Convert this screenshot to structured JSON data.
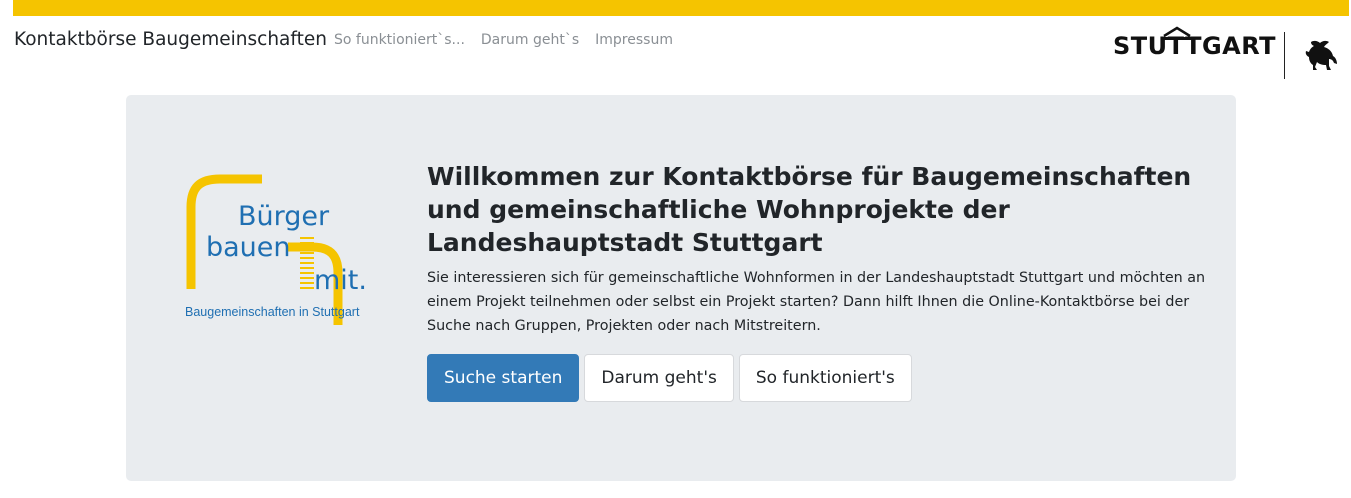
{
  "colors": {
    "accent_yellow": "#f5c400",
    "primary_blue": "#337ab7",
    "jumbotron_bg": "#e9ecef"
  },
  "navbar": {
    "brand": "Kontaktbörse Baugemeinschaften",
    "links": [
      "So funktioniert`s...",
      "Darum geht`s",
      "Impressum"
    ],
    "city_logo": "STUTTGART",
    "crest_icon": "horse-crest-icon"
  },
  "hero": {
    "logo": {
      "line1": "Bürger",
      "line2": "bauen",
      "line3": "mit.",
      "tagline": "Baugemeinschaften in Stuttgart"
    },
    "title": "Willkommen zur Kontaktbörse für Baugemeinschaften und gemeinschaftliche Wohnprojekte der Landeshauptstadt Stuttgart",
    "lead": "Sie interessieren sich für gemeinschaftliche Wohnformen in der Landeshauptstadt Stuttgart und möchten an einem Projekt teilnehmen oder selbst ein Projekt starten? Dann hilft Ihnen die Online-Kontaktbörse bei der Suche nach Gruppen, Projekten oder nach Mitstreitern.",
    "buttons": {
      "search": "Suche starten",
      "about": "Darum geht's",
      "howto": "So funktioniert's"
    }
  }
}
